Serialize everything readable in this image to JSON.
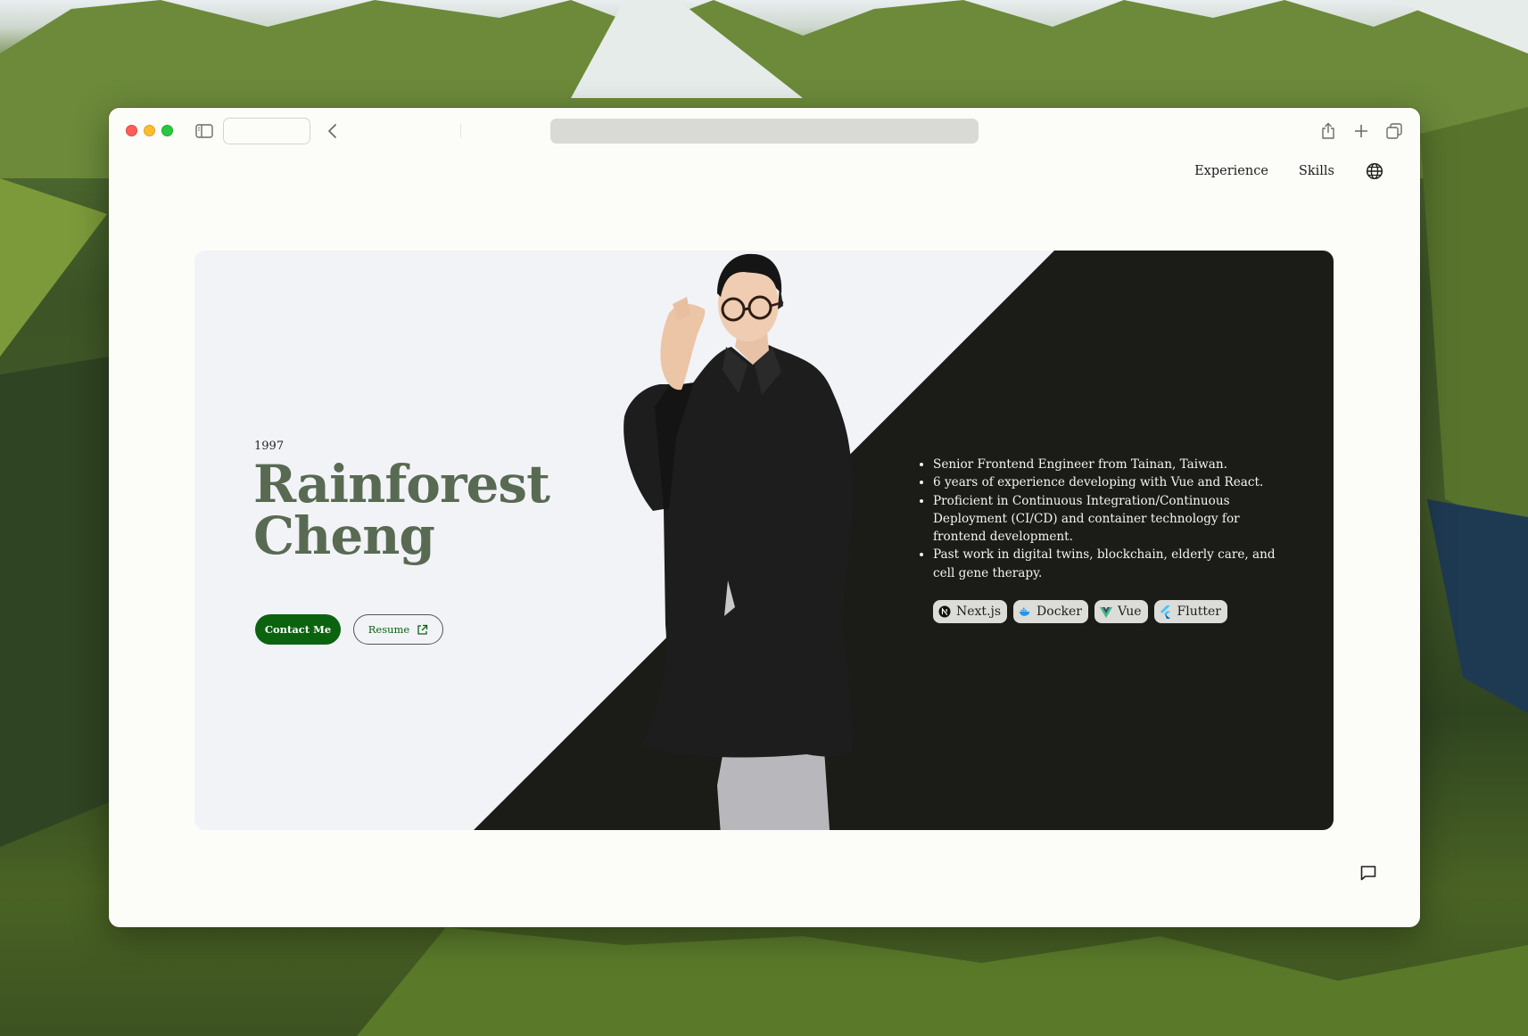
{
  "nav": {
    "items": [
      {
        "label": "Experience"
      },
      {
        "label": "Skills"
      }
    ],
    "language_icon": "globe-icon"
  },
  "hero": {
    "year": "1997",
    "first_name": "Rainforest",
    "last_name": "Cheng",
    "contact_label": "Contact Me",
    "resume_label": "Resume",
    "bullets": [
      "Senior Frontend Engineer from Tainan, Taiwan.",
      "6 years of experience developing with Vue and React.",
      "Proficient in Continuous Integration/Continuous Deployment (CI/CD) and container technology for frontend development.",
      "Past work in digital twins, blockchain, elderly care, and cell gene therapy."
    ],
    "tags": [
      {
        "label": "Next.js",
        "icon": "nextjs-icon",
        "color": "#111111"
      },
      {
        "label": "Docker",
        "icon": "docker-icon",
        "color": "#2496ed"
      },
      {
        "label": "Vue",
        "icon": "vue-icon",
        "color": "#41b883"
      },
      {
        "label": "Flutter",
        "icon": "flutter-icon",
        "color": "#47c5fb"
      }
    ]
  },
  "colors": {
    "accent": "#0b6310",
    "name_text": "#596a53",
    "dark_panel": "#1b1b17",
    "light_panel": "#f2f3f7"
  }
}
